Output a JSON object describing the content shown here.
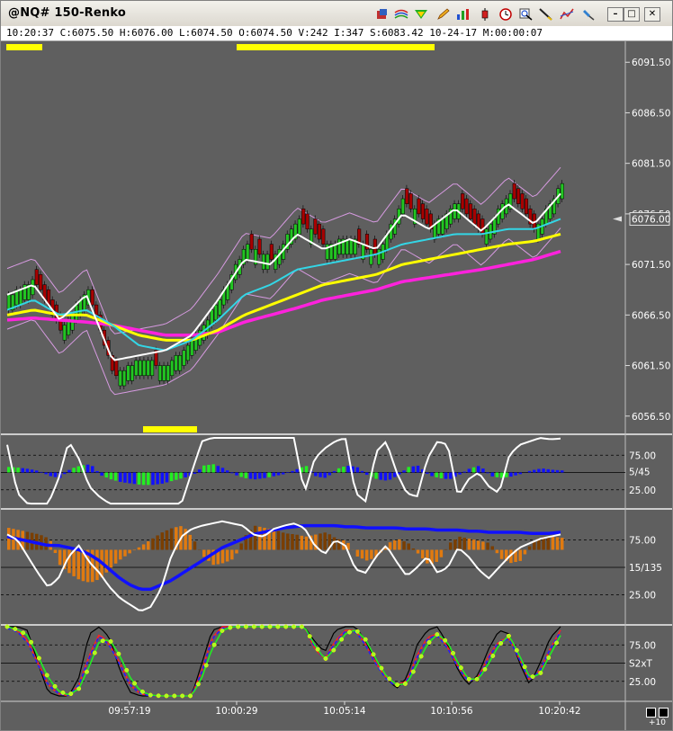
{
  "window": {
    "title": "@NQ# 150-Renko",
    "toolbar_icons": [
      "quote-icon",
      "chart-style-icon",
      "indicator-icon",
      "pencil-icon",
      "bar-chart-icon",
      "candlestick-icon",
      "clock-icon",
      "search-icon",
      "draw-line-icon",
      "trend-icon",
      "pin-icon",
      "minimize-icon",
      "maximize-icon",
      "close-icon"
    ],
    "minimize_label": "–",
    "maximize_label": "□",
    "close_label": "✕"
  },
  "infobar": {
    "text": "10:20:37  C:6075.50  H:6076.00  L:6074.50  O:6074.50  V:242  I:347  S:6083.42  10-24-17  M:00:00:07"
  },
  "colors": {
    "background": "#5f5f5f",
    "up_brick": "#22c422",
    "down_brick": "#a80000",
    "white_line": "#ffffff",
    "cyan_line": "#33d6e6",
    "yellow_line": "#ffff00",
    "magenta_line": "#ff22dd",
    "envelope": "#d69ae0",
    "blue_hist": "#1010ff",
    "green_hist": "#22ee22",
    "orange_hist": "#e07a10",
    "brown_hist": "#7a3e00",
    "highlight_bar": "#ffff00"
  },
  "chart_data": [
    {
      "type": "line",
      "panel": "price",
      "title": "@NQ# 150-Renko",
      "y_ticks": [
        "6091.50",
        "6086.50",
        "6081.50",
        "6076.50",
        "6071.50",
        "6066.50",
        "6061.50",
        "6056.50"
      ],
      "ylim": [
        6055.5,
        6092.5
      ],
      "last_price_label": "6076.00",
      "brick_size": 0.5,
      "brick_path": [
        6068.5,
        6070.0,
        6065.0,
        6069.0,
        6060.5,
        6062.0,
        6061.5,
        6064.0,
        6068.0,
        6073.5,
        6072.0,
        6076.0,
        6073.5,
        6074.0,
        6072.5,
        6078.0,
        6075.0,
        6077.5,
        6074.5,
        6078.5,
        6075.0,
        6079.5
      ],
      "series": [
        {
          "name": "",
          "color": "white",
          "values": [
            6068.5,
            6069.5,
            6066.0,
            6068.5,
            6062.0,
            6062.5,
            6063.0,
            6064.5,
            6068.0,
            6072.0,
            6071.5,
            6074.5,
            6073.0,
            6074.0,
            6073.0,
            6076.5,
            6075.0,
            6077.0,
            6074.8,
            6077.5,
            6075.5,
            6078.5
          ]
        },
        {
          "name": "",
          "color": "cyan",
          "values": [
            6067.0,
            6068.0,
            6066.5,
            6067.0,
            6065.5,
            6063.5,
            6063.0,
            6064.0,
            6066.0,
            6068.5,
            6069.5,
            6071.0,
            6071.5,
            6072.0,
            6072.5,
            6073.5,
            6074.0,
            6074.5,
            6074.5,
            6075.0,
            6075.0,
            6076.0
          ]
        },
        {
          "name": "",
          "color": "yellow",
          "values": [
            6066.5,
            6067.0,
            6066.5,
            6066.5,
            6065.5,
            6064.5,
            6064.0,
            6064.0,
            6065.0,
            6066.5,
            6067.5,
            6068.5,
            6069.5,
            6070.0,
            6070.5,
            6071.5,
            6072.0,
            6072.5,
            6073.0,
            6073.5,
            6073.8,
            6074.5
          ]
        },
        {
          "name": "",
          "color": "magenta",
          "values": [
            6066.0,
            6066.2,
            6066.0,
            6065.8,
            6065.5,
            6065.0,
            6064.5,
            6064.5,
            6064.8,
            6065.8,
            6066.5,
            6067.2,
            6068.0,
            6068.5,
            6069.0,
            6069.8,
            6070.2,
            6070.6,
            6071.0,
            6071.5,
            6072.0,
            6072.8
          ]
        }
      ]
    },
    {
      "type": "bar",
      "panel": "oscillator-1",
      "y_ticks": [
        "75.00",
        "25.00"
      ],
      "label": "5/45",
      "ylim": [
        0,
        100
      ],
      "histogram": [
        8,
        7,
        5,
        2,
        -5,
        -8,
        5,
        10,
        12,
        -4,
        -10,
        -14,
        -16,
        -18,
        -18,
        -16,
        -12,
        -8,
        -4,
        10,
        12,
        6,
        -3,
        -8,
        -10,
        -8,
        -5,
        -2,
        4,
        10,
        -6,
        -8,
        5,
        10,
        8,
        -4,
        -10,
        -12,
        -4,
        8,
        10,
        -4,
        -8,
        -10,
        -3,
        6,
        10,
        -5,
        -8,
        -6,
        -2,
        3,
        6,
        4,
        3
      ],
      "line": [
        90,
        20,
        5,
        5,
        5,
        40,
        95,
        70,
        30,
        15,
        5,
        5,
        5,
        5,
        5,
        5,
        5,
        5,
        50,
        95,
        100,
        100,
        100,
        100,
        100,
        100,
        100,
        100,
        100,
        20,
        70,
        85,
        95,
        100,
        20,
        8,
        80,
        95,
        50,
        20,
        15,
        70,
        95,
        90,
        15,
        40,
        50,
        30,
        20,
        75,
        90,
        95,
        100,
        98,
        99
      ]
    },
    {
      "type": "bar",
      "panel": "oscillator-2",
      "y_ticks": [
        "75.00",
        "25.00"
      ],
      "label": "15/135",
      "ylim": [
        0,
        100
      ],
      "histogram": [
        20,
        18,
        16,
        14,
        10,
        -14,
        -22,
        -28,
        -30,
        -26,
        -16,
        -8,
        -2,
        4,
        10,
        16,
        20,
        22,
        10,
        -6,
        -14,
        -12,
        -8,
        12,
        22,
        20,
        18,
        15,
        14,
        12,
        14,
        16,
        10,
        8,
        -6,
        -10,
        -6,
        6,
        10,
        6,
        -4,
        -14,
        -10,
        6,
        12,
        10,
        8,
        6,
        -8,
        -12,
        -10,
        6,
        12,
        12,
        11
      ],
      "line": [
        80,
        75,
        60,
        45,
        32,
        40,
        60,
        70,
        55,
        45,
        32,
        22,
        16,
        10,
        14,
        30,
        60,
        78,
        85,
        88,
        90,
        92,
        90,
        88,
        80,
        78,
        85,
        88,
        90,
        86,
        70,
        62,
        75,
        70,
        48,
        45,
        60,
        70,
        55,
        42,
        50,
        60,
        45,
        50,
        68,
        60,
        48,
        40,
        50,
        60,
        68,
        72,
        76,
        78,
        80
      ],
      "slow_line": [
        78,
        76,
        74,
        72,
        70,
        70,
        68,
        66,
        62,
        56,
        48,
        40,
        34,
        30,
        30,
        34,
        38,
        44,
        50,
        56,
        62,
        68,
        72,
        76,
        80,
        82,
        84,
        86,
        87,
        88,
        88,
        88,
        88,
        87,
        87,
        86,
        86,
        86,
        86,
        85,
        85,
        85,
        84,
        84,
        84,
        83,
        83,
        82,
        82,
        82,
        82,
        81,
        81,
        81,
        82
      ]
    },
    {
      "type": "line",
      "panel": "oscillator-3",
      "y_ticks": [
        "75.00",
        "25.00"
      ],
      "label": "S2xT",
      "ylim": [
        0,
        100
      ],
      "series": [
        {
          "name": "",
          "color": "black",
          "values": [
            100,
            100,
            95,
            50,
            10,
            5,
            5,
            30,
            90,
            100,
            85,
            40,
            10,
            5,
            5,
            5,
            5,
            5,
            5,
            50,
            95,
            100,
            100,
            100,
            100,
            100,
            100,
            100,
            100,
            100,
            80,
            65,
            95,
            100,
            100,
            80,
            50,
            30,
            15,
            30,
            75,
            95,
            100,
            75,
            40,
            20,
            35,
            70,
            95,
            90,
            50,
            20,
            50,
            85,
            100
          ]
        },
        {
          "name": "",
          "color": "red",
          "values": [
            100,
            95,
            80,
            50,
            20,
            8,
            5,
            20,
            60,
            90,
            75,
            50,
            20,
            8,
            5,
            5,
            5,
            5,
            5,
            40,
            85,
            100,
            100,
            100,
            100,
            100,
            100,
            100,
            100,
            100,
            70,
            55,
            80,
            95,
            95,
            75,
            50,
            30,
            20,
            25,
            60,
            85,
            90,
            72,
            45,
            25,
            30,
            60,
            80,
            85,
            55,
            25,
            40,
            70,
            95
          ]
        },
        {
          "name": "",
          "color": "blue",
          "values": [
            98,
            93,
            78,
            48,
            20,
            8,
            5,
            20,
            58,
            88,
            74,
            48,
            20,
            8,
            5,
            5,
            5,
            5,
            5,
            38,
            84,
            98,
            100,
            100,
            100,
            100,
            100,
            100,
            100,
            100,
            72,
            55,
            78,
            94,
            94,
            74,
            48,
            28,
            18,
            24,
            58,
            84,
            88,
            70,
            44,
            25,
            30,
            58,
            80,
            83,
            55,
            25,
            40,
            70,
            93
          ]
        },
        {
          "name": "",
          "color": "green",
          "values": [
            100,
            96,
            88,
            60,
            30,
            12,
            6,
            15,
            45,
            80,
            82,
            60,
            30,
            12,
            6,
            5,
            5,
            5,
            5,
            30,
            70,
            95,
            100,
            100,
            100,
            100,
            100,
            100,
            100,
            100,
            75,
            55,
            70,
            90,
            96,
            82,
            55,
            32,
            20,
            22,
            48,
            76,
            90,
            78,
            50,
            28,
            28,
            50,
            75,
            88,
            60,
            30,
            35,
            62,
            88
          ]
        }
      ]
    }
  ],
  "x_axis": {
    "tick_labels": [
      "09:57:19",
      "10:00:29",
      "10:05:14",
      "10:10:56",
      "10:20:42"
    ],
    "corner_label": "+10"
  }
}
